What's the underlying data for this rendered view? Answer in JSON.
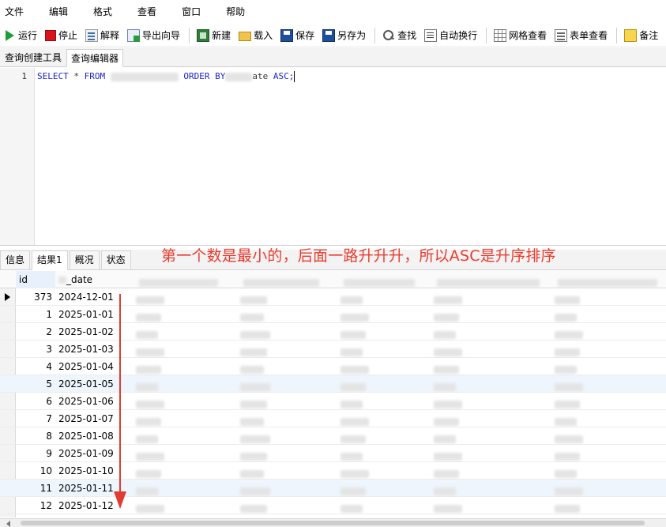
{
  "menu": [
    "文件",
    "编辑",
    "格式",
    "查看",
    "窗口",
    "帮助"
  ],
  "toolbar": {
    "run": "运行",
    "stop": "停止",
    "explain": "解释",
    "export_wizard": "导出向导",
    "new": "新建",
    "load": "载入",
    "save": "保存",
    "save_as": "另存为",
    "find": "查找",
    "word_wrap": "自动换行",
    "grid_view": "网格查看",
    "form_view": "表单查看",
    "note": "备注"
  },
  "editor_tabs": [
    "查询创建工具",
    "查询编辑器"
  ],
  "editor": {
    "line_number": "1",
    "sql": {
      "select": "SELECT",
      "star": "*",
      "from": "FROM",
      "order_by": "ORDER BY",
      "column_tail": "ate",
      "asc": "ASC;"
    }
  },
  "result_tabs": [
    "信息",
    "结果1",
    "概况",
    "状态"
  ],
  "annotation": "第一个数是最小的，后面一路升升升，所以ASC是升序排序",
  "grid": {
    "headers": {
      "id": "id",
      "date": "_date"
    },
    "rows": [
      {
        "id": "373",
        "date": "2024-12-01"
      },
      {
        "id": "1",
        "date": "2025-01-01"
      },
      {
        "id": "2",
        "date": "2025-01-02"
      },
      {
        "id": "3",
        "date": "2025-01-03"
      },
      {
        "id": "4",
        "date": "2025-01-04"
      },
      {
        "id": "5",
        "date": "2025-01-05"
      },
      {
        "id": "6",
        "date": "2025-01-06"
      },
      {
        "id": "7",
        "date": "2025-01-07"
      },
      {
        "id": "8",
        "date": "2025-01-08"
      },
      {
        "id": "9",
        "date": "2025-01-09"
      },
      {
        "id": "10",
        "date": "2025-01-10"
      },
      {
        "id": "11",
        "date": "2025-01-11"
      },
      {
        "id": "12",
        "date": "2025-01-12"
      }
    ]
  },
  "colors": {
    "keyword": "#1b24c9",
    "annotation": "#ea3a2c",
    "arrow": "#e23b32",
    "row_highlight": "#eef5fd"
  }
}
